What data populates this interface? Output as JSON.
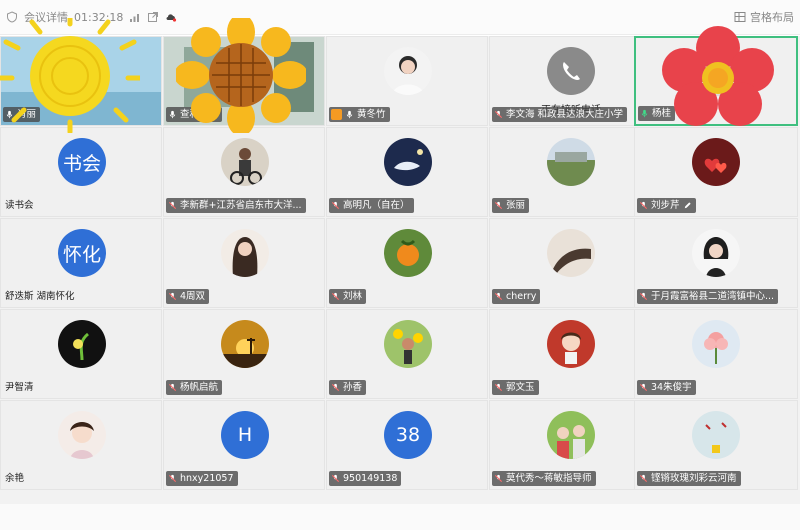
{
  "topbar": {
    "meeting_info": "会议详情",
    "timer": "01:32:18",
    "layout_label": "宫格布局"
  },
  "tiles": [
    {
      "name": "肖丽",
      "avatar_text": ""
    },
    {
      "name": "查和特乡",
      "avatar_text": ""
    },
    {
      "name": "黄冬竹",
      "avatar_text": ""
    },
    {
      "name": "李文海 和政县达浪大庄小学",
      "avatar_text": "",
      "status": "正在接听电话"
    },
    {
      "name": "杨桂",
      "avatar_text": ""
    },
    {
      "name": "读书会",
      "avatar_text": "书会"
    },
    {
      "name": "李新群+江苏省启东市大洋...",
      "avatar_text": ""
    },
    {
      "name": "高明凡（自在）",
      "avatar_text": ""
    },
    {
      "name": "张丽",
      "avatar_text": ""
    },
    {
      "name": "刘步芹",
      "avatar_text": ""
    },
    {
      "name": "舒迭斯 湖南怀化",
      "avatar_text": "怀化"
    },
    {
      "name": "4周双",
      "avatar_text": ""
    },
    {
      "name": "刘林",
      "avatar_text": ""
    },
    {
      "name": "cherry",
      "avatar_text": ""
    },
    {
      "name": "于月霞富裕县二道湾镇中心...",
      "avatar_text": ""
    },
    {
      "name": "尹智清",
      "avatar_text": ""
    },
    {
      "name": "杨帆启航",
      "avatar_text": ""
    },
    {
      "name": "孙香",
      "avatar_text": ""
    },
    {
      "name": "郭文玉",
      "avatar_text": ""
    },
    {
      "name": "34朱俊宇",
      "avatar_text": ""
    },
    {
      "name": "余艳",
      "avatar_text": ""
    },
    {
      "name": "hnxy21057",
      "avatar_text": "H"
    },
    {
      "name": "950149138",
      "avatar_text": "38"
    },
    {
      "name": "莫代秀～蒋敏指导师",
      "avatar_text": ""
    },
    {
      "name": "铿锵玫瑰刘彩云河南",
      "avatar_text": ""
    }
  ],
  "colors": {
    "avatar_blue": "#2f6fd6",
    "active_border": "#3fbf7f",
    "label_bg": "#464646"
  }
}
